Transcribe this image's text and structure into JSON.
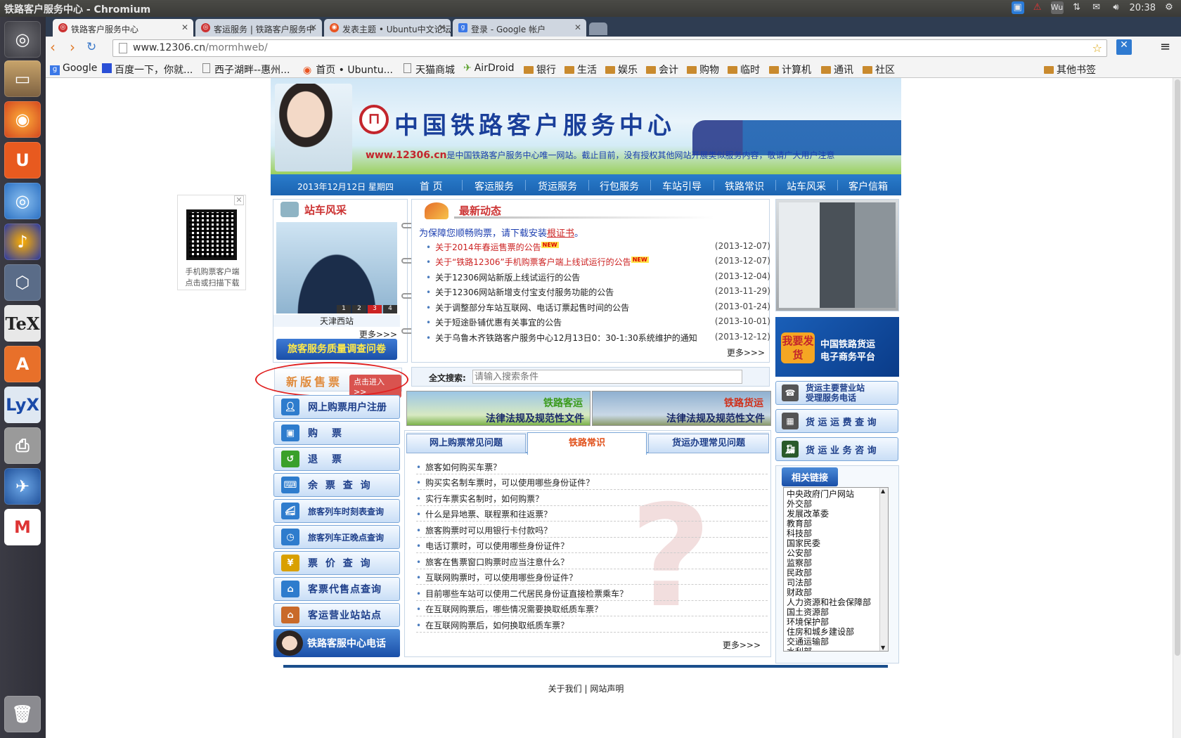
{
  "window": {
    "title": "铁路客户服务中心 - Chromium",
    "clock": "20:38"
  },
  "tabs": [
    {
      "label": "铁路客户服务中心"
    },
    {
      "label": "客运服务 | 铁路客户服务中"
    },
    {
      "label": "发表主题 • Ubuntu中文论坛"
    },
    {
      "label": "登录 - Google 帐户"
    }
  ],
  "address": {
    "host": "www.12306.cn",
    "path": "/mormhweb/"
  },
  "bookmarks": [
    "Google",
    "百度一下，你就...",
    "西子湖畔--惠州...",
    "首页 • Ubuntu...",
    "天猫商城",
    "AirDroid",
    "银行",
    "生活",
    "娱乐",
    "会计",
    "购物",
    "临时",
    "计算机",
    "通讯",
    "社区"
  ],
  "bookmarks_other": "其他书签",
  "banner": {
    "title": "中国铁路客户服务中心",
    "notice_site": "www.12306.cn",
    "notice_text": "是中国铁路客户服务中心唯一网站。截止目前，没有授权其他网站开展类似服务内容，敬请广大用户注意"
  },
  "nav": {
    "date": "2013年12月12日 星期四",
    "items": [
      "首 页",
      "客运服务",
      "货运服务",
      "行包服务",
      "车站引导",
      "铁路常识",
      "站车风采",
      "客户信箱"
    ]
  },
  "qr": {
    "caption1": "手机购票客户端",
    "caption2": "点击或扫描下载"
  },
  "station": {
    "heading": "站车风采",
    "caption": "天津西站",
    "pages": [
      "1",
      "2",
      "3",
      "4"
    ],
    "more": "更多>>>",
    "survey": "旅客服务质量调查问卷"
  },
  "news": {
    "heading": "最新动态",
    "cert_prefix": "为保障您顺畅购票，请下载安装",
    "cert_link": "根证书",
    "cert_suffix": "。",
    "items": [
      {
        "title": "关于2014年春运售票的公告",
        "date": "(2013-12-07)",
        "new": "NEW"
      },
      {
        "title": "关于“铁路12306”手机购票客户端上线试运行的公告",
        "date": "(2013-12-07)",
        "new": "NEW"
      },
      {
        "title": "关于12306网站新版上线试运行的公告",
        "date": "(2013-12-04)",
        "new": ""
      },
      {
        "title": "关于12306网站新增支付宝支付服务功能的公告",
        "date": "(2013-11-29)",
        "new": ""
      },
      {
        "title": "关于调整部分车站互联网、电话订票起售时间的公告",
        "date": "(2013-01-24)",
        "new": ""
      },
      {
        "title": "关于短途卧铺优惠有关事宜的公告",
        "date": "(2013-10-01)",
        "new": ""
      },
      {
        "title": "关于乌鲁木齐铁路客户服务中心12月13日0：30-1:30系统维护的通知",
        "date": "(2013-12-12)",
        "new": ""
      }
    ],
    "more": "更多>>>"
  },
  "newsale": {
    "label": "新版售票",
    "enter": "点击进入>>"
  },
  "search": {
    "label": "全文搜索:",
    "placeholder": "请输入搜索条件"
  },
  "law": [
    {
      "top": "铁路客运",
      "bottom": "法律法规及规范性文件"
    },
    {
      "top": "铁路货运",
      "bottom": "法律法规及规范性文件"
    }
  ],
  "left_buttons": [
    "网上购票用户注册",
    "购　票",
    "退　票",
    "余 票 查 询",
    "旅客列车时刻表查询",
    "旅客列车正晚点查询",
    "票 价 查 询",
    "客票代售点查询",
    "客运营业站站点",
    "铁路客服中心电话"
  ],
  "faq": {
    "tabs": [
      "网上购票常见问题",
      "铁路常识",
      "货运办理常见问题"
    ],
    "items": [
      "旅客如何购买车票？",
      "购买实名制车票时，可以使用哪些身份证件？",
      "实行车票实名制时，如何购票？",
      "什么是异地票、联程票和往返票？",
      "旅客购票时可以用银行卡付款吗？",
      "电话订票时，可以使用哪些身份证件？",
      "旅客在售票窗口购票时应当注意什么？",
      "互联网购票时，可以使用哪些身份证件？",
      "目前哪些车站可以使用二代居民身份证直接检票乘车？",
      "在互联网购票后，哪些情况需要换取纸质车票？",
      "在互联网购票后，如何换取纸质车票？"
    ],
    "more": "更多>>>"
  },
  "right": {
    "ecom_badge": "我要发货",
    "ecom_line1": "中国铁路货运",
    "ecom_line2": "电子商务平台",
    "buttons": [
      {
        "line1": "货运主要营业站",
        "line2": "受理服务电话"
      },
      {
        "line1": "货 运 运 费 查 询",
        "line2": ""
      },
      {
        "line1": "货 运 业 务 咨 询",
        "line2": ""
      }
    ],
    "links_heading": "相关链接",
    "links": [
      "中央政府门户网站",
      "外交部",
      "发展改革委",
      "教育部",
      "科技部",
      "国家民委",
      "公安部",
      "监察部",
      "民政部",
      "司法部",
      "财政部",
      "人力资源和社会保障部",
      "国土资源部",
      "环境保护部",
      "住房和城乡建设部",
      "交通运输部",
      "水利部"
    ]
  },
  "footer": {
    "text": "关于我们 | 网站声明"
  },
  "colors": {
    "nav_blue": "#1b63b0",
    "news_red": "#cc2222",
    "link_blue": "#1d3fb0"
  }
}
